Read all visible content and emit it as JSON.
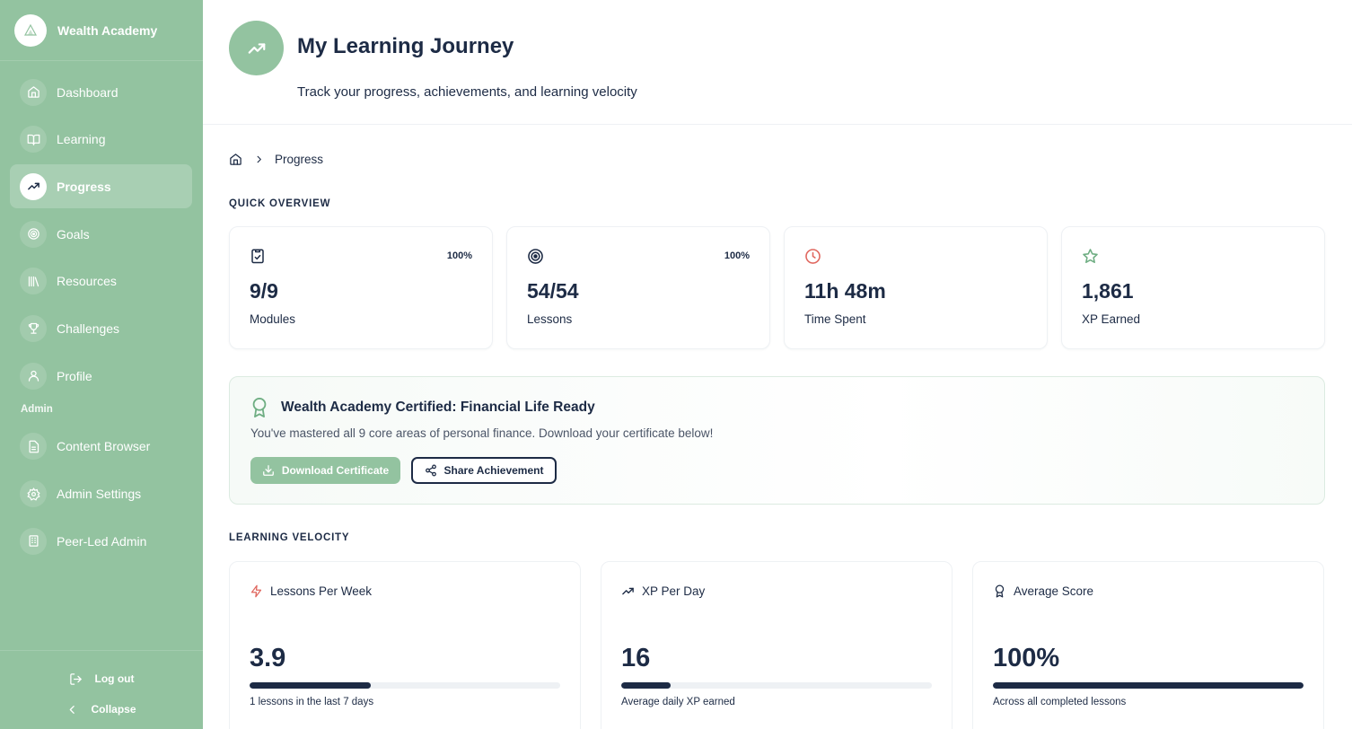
{
  "brand": {
    "name": "Wealth Academy"
  },
  "nav": {
    "items": [
      {
        "label": "Dashboard",
        "icon": "home-icon"
      },
      {
        "label": "Learning",
        "icon": "book-icon"
      },
      {
        "label": "Progress",
        "icon": "trending-up-icon",
        "active": true
      },
      {
        "label": "Goals",
        "icon": "target-icon"
      },
      {
        "label": "Resources",
        "icon": "library-icon"
      },
      {
        "label": "Challenges",
        "icon": "trophy-icon"
      },
      {
        "label": "Profile",
        "icon": "user-icon"
      }
    ],
    "admin_section": "Admin",
    "admin_items": [
      {
        "label": "Content Browser",
        "icon": "file-icon"
      },
      {
        "label": "Admin Settings",
        "icon": "gear-icon"
      },
      {
        "label": "Peer-Led Admin",
        "icon": "building-icon"
      }
    ],
    "logout": "Log out",
    "collapse": "Collapse"
  },
  "header": {
    "title": "My Learning Journey",
    "subtitle": "Track your progress, achievements, and learning velocity"
  },
  "breadcrumb": {
    "current": "Progress"
  },
  "overview": {
    "title": "QUICK OVERVIEW",
    "cards": [
      {
        "value": "9/9",
        "label": "Modules",
        "pct": "100%",
        "icon": "clipboard-check-icon"
      },
      {
        "value": "54/54",
        "label": "Lessons",
        "pct": "100%",
        "icon": "target-icon"
      },
      {
        "value": "11h 48m",
        "label": "Time Spent",
        "pct": "",
        "icon": "clock-icon"
      },
      {
        "value": "1,861",
        "label": "XP Earned",
        "pct": "",
        "icon": "star-icon"
      }
    ]
  },
  "certificate": {
    "title": "Wealth Academy Certified: Financial Life Ready",
    "text": "You've mastered all 9 core areas of personal finance. Download your certificate below!",
    "download_label": "Download Certificate",
    "share_label": "Share Achievement"
  },
  "velocity": {
    "title": "LEARNING VELOCITY",
    "cards": [
      {
        "title": "Lessons Per Week",
        "value": "3.9",
        "note": "1 lessons in the last 7 days",
        "progress": 0.39,
        "icon": "zap-icon"
      },
      {
        "title": "XP Per Day",
        "value": "16",
        "note": "Average daily XP earned",
        "progress": 0.16,
        "icon": "trending-up-icon"
      },
      {
        "title": "Average Score",
        "value": "100%",
        "note": "Across all completed lessons",
        "progress": 1.0,
        "icon": "award-icon"
      }
    ]
  },
  "colors": {
    "sidebar": "#93c3a0",
    "navy": "#1d2b45",
    "accent_red": "#e0675f",
    "accent_green": "#6fae83"
  }
}
